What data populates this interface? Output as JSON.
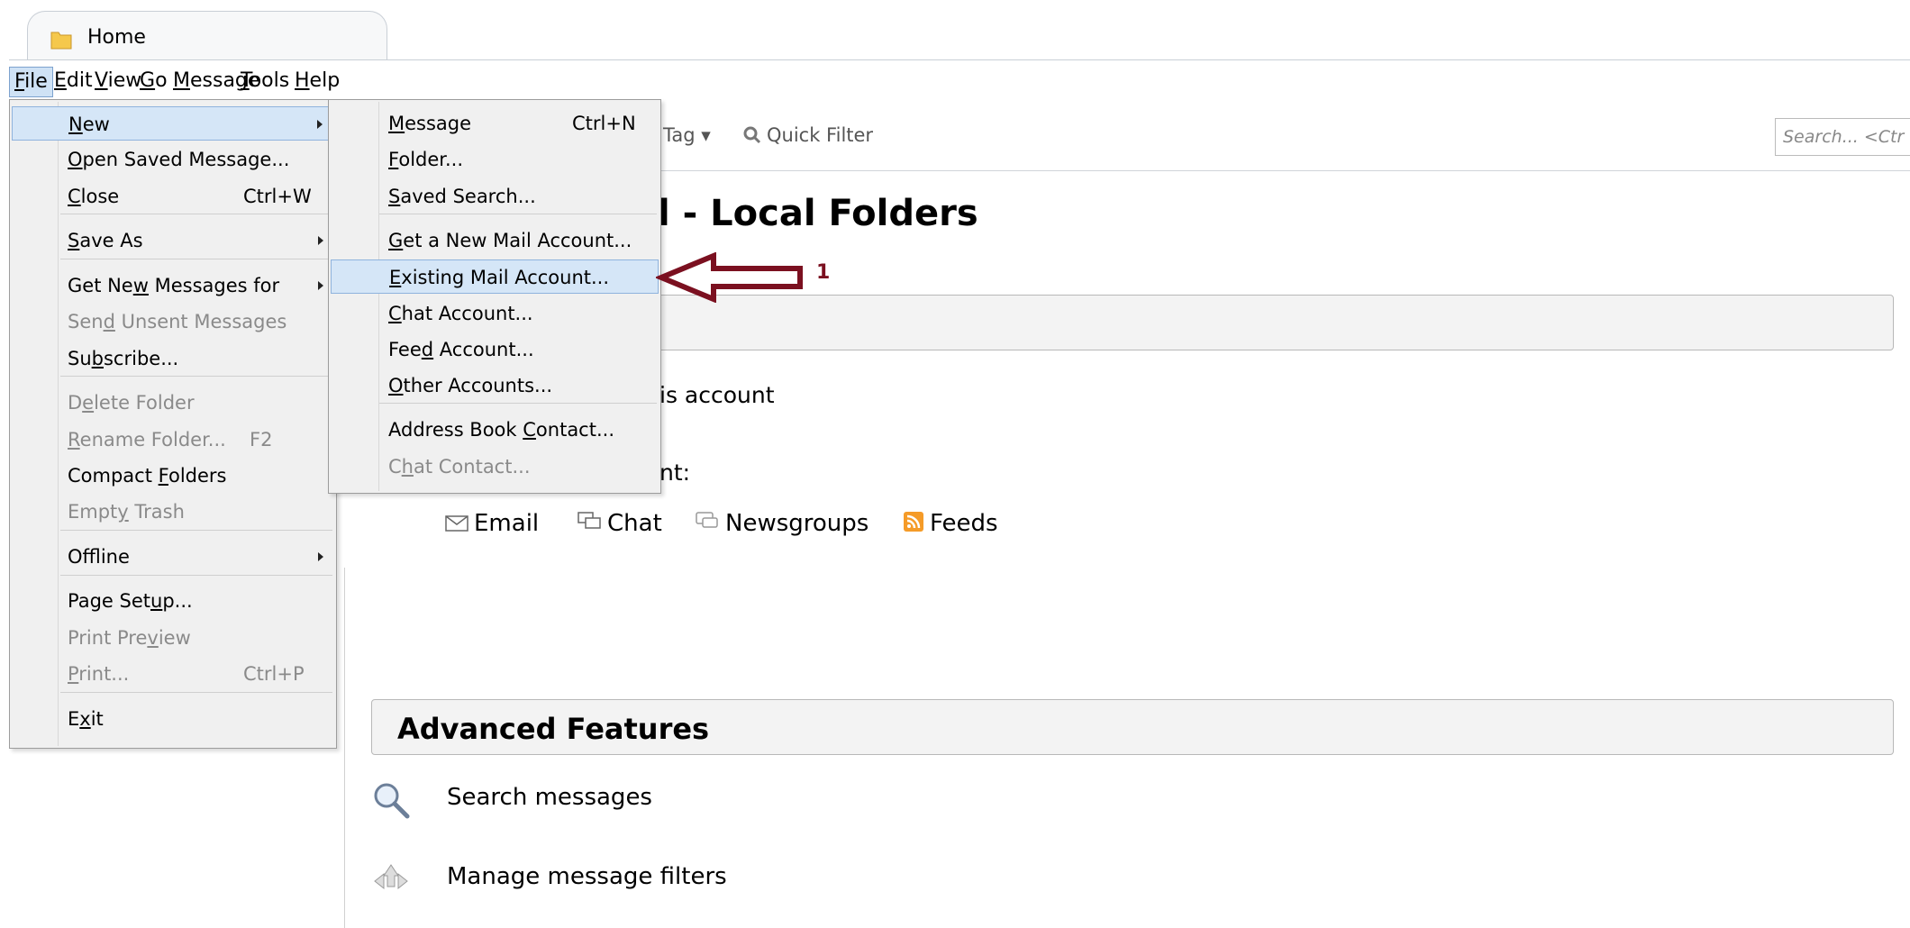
{
  "tab": {
    "label": "Home"
  },
  "menubar": [
    {
      "label": "File",
      "u": 0
    },
    {
      "label": "Edit",
      "u": 0
    },
    {
      "label": "View",
      "u": 0
    },
    {
      "label": "Go",
      "u": 0
    },
    {
      "label": "Message",
      "u": 0
    },
    {
      "label": "Tools",
      "u": 0
    },
    {
      "label": "Help",
      "u": 0
    }
  ],
  "toolbar": {
    "tag_label": "Tag",
    "quick_filter_label": "Quick Filter",
    "search_placeholder": "Search... <Ctr"
  },
  "main": {
    "account_title": "l - Local Folders",
    "read_text": "is account",
    "create_text": "nt:",
    "create_links": [
      {
        "label": "Email",
        "icon": "envelope-icon"
      },
      {
        "label": "Chat",
        "icon": "chat-icon"
      },
      {
        "label": "Newsgroups",
        "icon": "newsgroups-icon"
      },
      {
        "label": "Feeds",
        "icon": "rss-feed-icon"
      }
    ],
    "advanced_title": "Advanced Features",
    "advanced_items": [
      {
        "label": "Search messages",
        "icon": "magnifier-icon"
      },
      {
        "label": "Manage message filters",
        "icon": "filter-icon"
      }
    ]
  },
  "file_menu": {
    "items": [
      {
        "label": "New",
        "u": "N",
        "shortcut": "",
        "submenu": true,
        "disabled": false,
        "highlighted": true
      },
      {
        "label": "Open Saved Message...",
        "u": "O",
        "shortcut": "",
        "submenu": false,
        "disabled": false
      },
      {
        "label": "Close",
        "u": "C",
        "shortcut": "Ctrl+W",
        "submenu": false,
        "disabled": false
      },
      {
        "label": "Save As",
        "u": "S",
        "shortcut": "",
        "submenu": true,
        "disabled": false
      },
      {
        "label": "Get New Messages for",
        "u": "w",
        "shortcut": "",
        "submenu": true,
        "disabled": false
      },
      {
        "label": "Send Unsent Messages",
        "u": "d",
        "shortcut": "",
        "submenu": false,
        "disabled": true
      },
      {
        "label": "Subscribe...",
        "u": "b",
        "shortcut": "",
        "submenu": false,
        "disabled": false
      },
      {
        "label": "Delete Folder",
        "u": "e",
        "shortcut": "",
        "submenu": false,
        "disabled": true
      },
      {
        "label": "Rename Folder...",
        "u": "R",
        "shortcut": "F2",
        "submenu": false,
        "disabled": true
      },
      {
        "label": "Compact Folders",
        "u": "F",
        "shortcut": "",
        "submenu": false,
        "disabled": false
      },
      {
        "label": "Empty Trash",
        "u": "y",
        "shortcut": "",
        "submenu": false,
        "disabled": true
      },
      {
        "label": "Offline",
        "u": "l",
        "shortcut": "",
        "submenu": true,
        "disabled": false
      },
      {
        "label": "Page Setup...",
        "u": "u",
        "shortcut": "",
        "submenu": false,
        "disabled": false
      },
      {
        "label": "Print Preview",
        "u": "v",
        "shortcut": "",
        "submenu": false,
        "disabled": true
      },
      {
        "label": "Print...",
        "u": "P",
        "shortcut": "Ctrl+P",
        "submenu": false,
        "disabled": true
      },
      {
        "label": "Exit",
        "u": "x",
        "shortcut": "",
        "submenu": false,
        "disabled": false
      }
    ]
  },
  "new_submenu": {
    "items": [
      {
        "label": "Message",
        "u": "M",
        "shortcut": "Ctrl+N",
        "disabled": false
      },
      {
        "label": "Folder...",
        "u": "F",
        "shortcut": "",
        "disabled": false
      },
      {
        "label": "Saved Search...",
        "u": "S",
        "shortcut": "",
        "disabled": false
      },
      {
        "label": "Get a New Mail Account...",
        "u": "G",
        "shortcut": "",
        "disabled": false
      },
      {
        "label": "Existing Mail Account...",
        "u": "E",
        "shortcut": "",
        "disabled": false,
        "highlighted": true
      },
      {
        "label": "Chat Account...",
        "u": "C",
        "shortcut": "",
        "disabled": false
      },
      {
        "label": "Feed Account...",
        "u": "d",
        "shortcut": "",
        "disabled": false
      },
      {
        "label": "Other Accounts...",
        "u": "O",
        "shortcut": "",
        "disabled": false
      },
      {
        "label": "Address Book Contact...",
        "u": "C",
        "shortcut": "",
        "disabled": false
      },
      {
        "label": "Chat Contact...",
        "u": "h",
        "shortcut": "",
        "disabled": true
      }
    ]
  },
  "annotation": {
    "number": "1",
    "color": "#7b1020"
  }
}
